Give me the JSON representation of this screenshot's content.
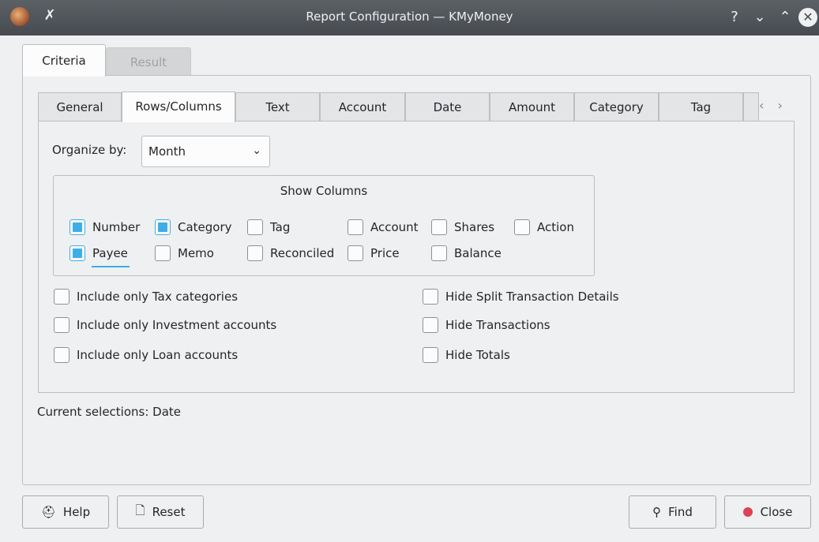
{
  "window": {
    "title": "Report Configuration — KMyMoney",
    "buttons": {
      "help": "?",
      "minimize": "⌄",
      "maximize": "⌃",
      "close": "✕"
    },
    "pin_glyph": "✗"
  },
  "outer_tabs": [
    {
      "label": "Criteria",
      "active": true
    },
    {
      "label": "Result",
      "active": false
    }
  ],
  "inner_tabs": [
    {
      "label": "General"
    },
    {
      "label": "Rows/Columns",
      "active": true
    },
    {
      "label": "Text"
    },
    {
      "label": "Account"
    },
    {
      "label": "Date"
    },
    {
      "label": "Amount"
    },
    {
      "label": "Category"
    },
    {
      "label": "Tag"
    }
  ],
  "tab_scroll_arrows": "‹ ›",
  "organize": {
    "label": "Organize by:",
    "value": "Month",
    "chevron": "⌄"
  },
  "show_columns": {
    "title": "Show Columns",
    "items": {
      "number": {
        "label": "Number",
        "checked": true
      },
      "category": {
        "label": "Category",
        "checked": true
      },
      "tag": {
        "label": "Tag",
        "checked": false
      },
      "account": {
        "label": "Account",
        "checked": false
      },
      "shares": {
        "label": "Shares",
        "checked": false
      },
      "action": {
        "label": "Action",
        "checked": false
      },
      "payee": {
        "label": "Payee",
        "checked": true
      },
      "memo": {
        "label": "Memo",
        "checked": false
      },
      "reconciled": {
        "label": "Reconciled",
        "checked": false
      },
      "price": {
        "label": "Price",
        "checked": false
      },
      "balance": {
        "label": "Balance",
        "checked": false
      }
    }
  },
  "options": {
    "tax": {
      "label": "Include only Tax categories",
      "checked": false
    },
    "investment": {
      "label": "Include only Investment accounts",
      "checked": false
    },
    "loan": {
      "label": "Include only Loan accounts",
      "checked": false
    },
    "hide_split": {
      "label": "Hide Split Transaction Details",
      "checked": false
    },
    "hide_transactions": {
      "label": "Hide Transactions",
      "checked": false
    },
    "hide_totals": {
      "label": "Hide Totals",
      "checked": false
    }
  },
  "status": {
    "current_selections": "Current selections: Date"
  },
  "buttons": {
    "help": {
      "label": "Help",
      "icon": "⛑"
    },
    "reset": {
      "label": "Reset",
      "icon": "🗋"
    },
    "find": {
      "label": "Find",
      "icon": "⚲"
    },
    "close": {
      "label": "Close"
    }
  },
  "colors": {
    "accent": "#3daee9",
    "titlebar": "#474b50",
    "close_red": "#da4453"
  }
}
